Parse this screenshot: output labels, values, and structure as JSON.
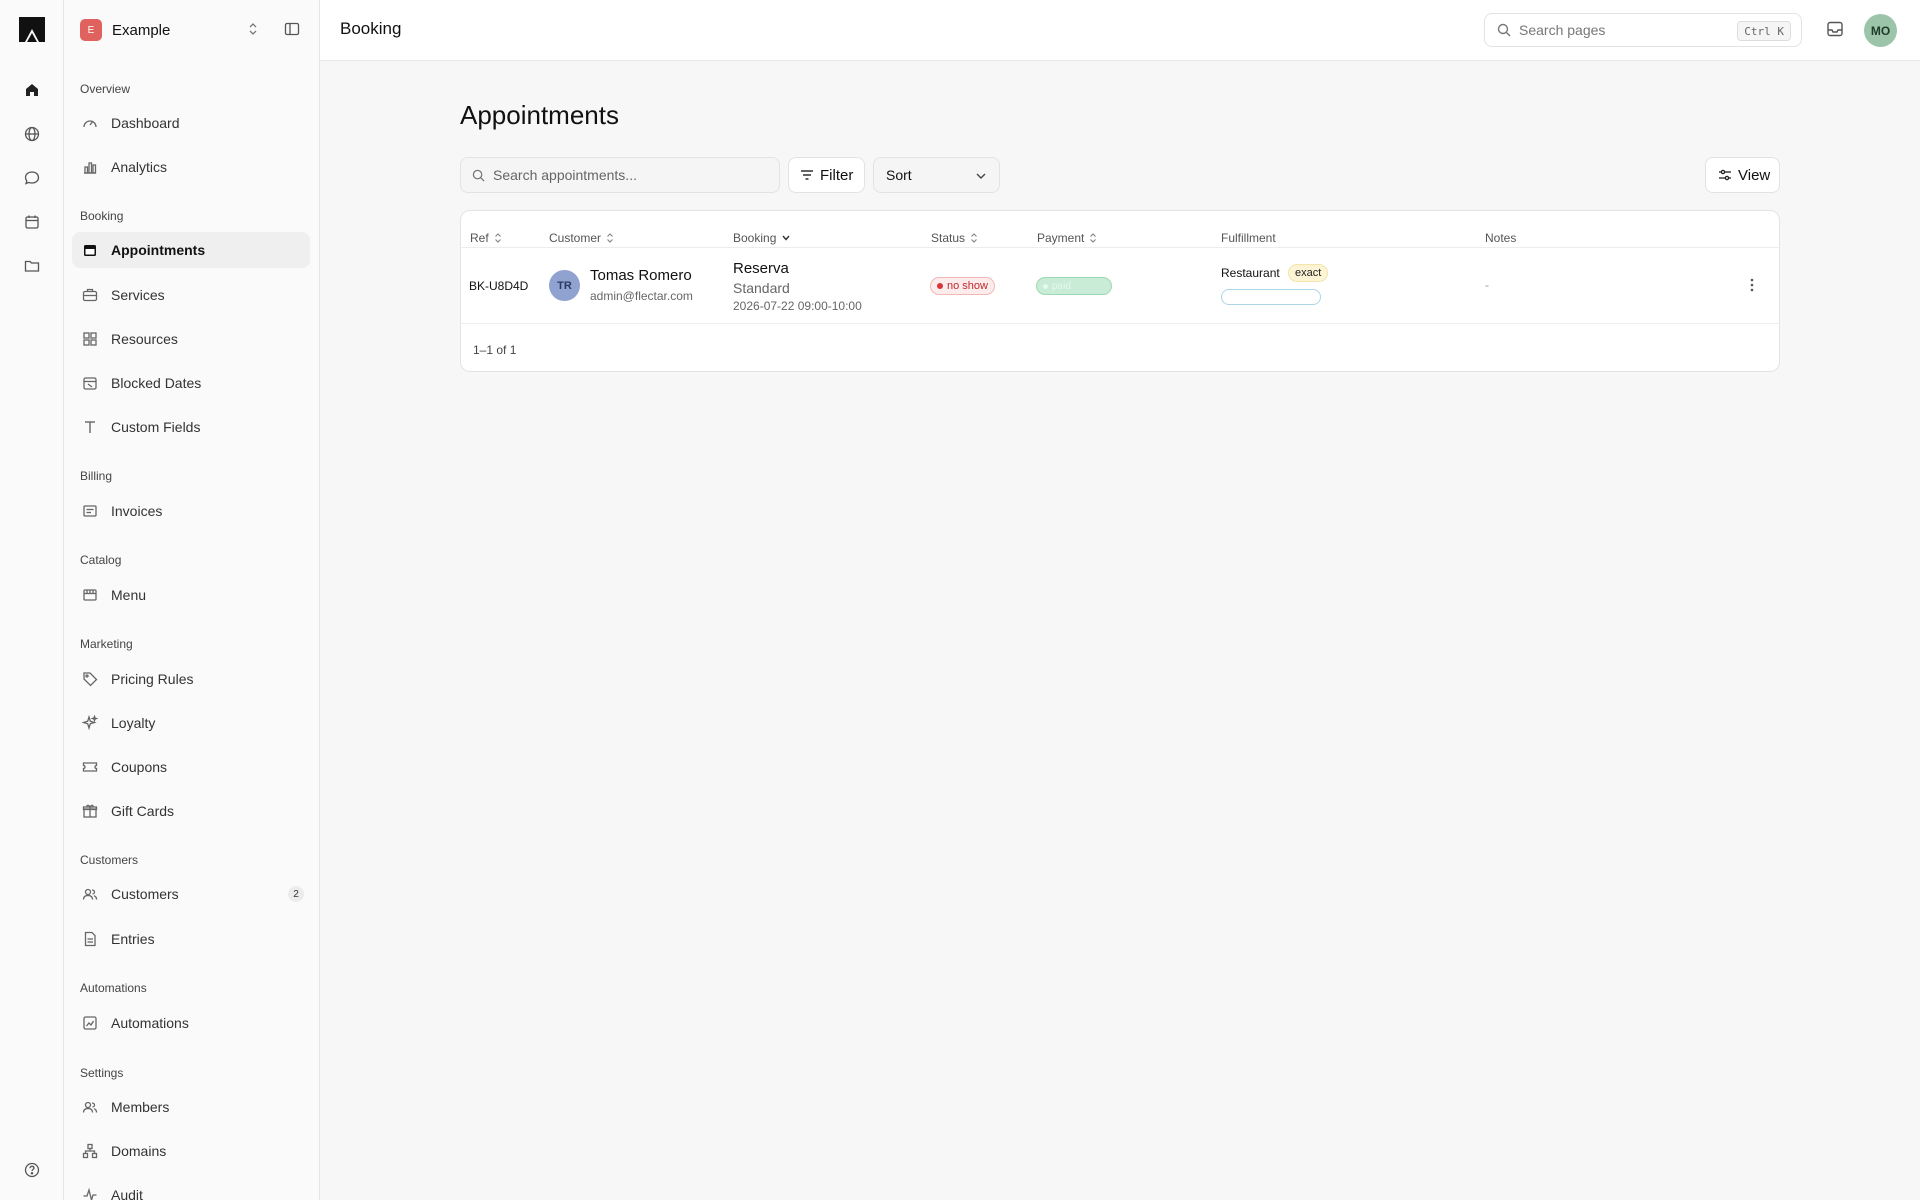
{
  "app": {
    "workspace_initial": "E",
    "workspace_name": "Example"
  },
  "header": {
    "title": "Booking",
    "search_placeholder": "Search pages",
    "shortcut": "Ctrl K",
    "avatar": "MO"
  },
  "sidebar": {
    "overview": "Overview",
    "dashboard": "Dashboard",
    "analytics": "Analytics",
    "booking": "Booking",
    "appointments": "Appointments",
    "services": "Services",
    "resources": "Resources",
    "blocked_dates": "Blocked Dates",
    "custom_fields": "Custom Fields",
    "billing": "Billing",
    "invoices": "Invoices",
    "catalog": "Catalog",
    "menu": "Menu",
    "marketing": "Marketing",
    "pricing_rules": "Pricing Rules",
    "loyalty": "Loyalty",
    "coupons": "Coupons",
    "gift_cards": "Gift Cards",
    "customers_section": "Customers",
    "customers": "Customers",
    "customers_count": "2",
    "entries": "Entries",
    "automations_section": "Automations",
    "automations": "Automations",
    "settings": "Settings",
    "members": "Members",
    "domains": "Domains",
    "audit": "Audit"
  },
  "main": {
    "title": "Appointments",
    "search_placeholder": "Search appointments...",
    "filter_label": "Filter",
    "sort_label": "Sort",
    "view_label": "View"
  },
  "table": {
    "columns": {
      "ref": "Ref",
      "customer": "Customer",
      "booking": "Booking",
      "status": "Status",
      "payment": "Payment",
      "fulfillment": "Fulfillment",
      "notes": "Notes"
    },
    "rows": [
      {
        "ref": "BK-U8D4D",
        "customer_initials": "TR",
        "customer_name": "Tomas Romero",
        "customer_email": "admin@flectar.com",
        "booking_title": "Reserva",
        "booking_type": "Standard",
        "booking_time": "2026-07-22 09:00-10:00",
        "status": "no show",
        "payment": "paid",
        "fulfillment": "Restaurant",
        "fulfillment_tag": "exact",
        "notes": "-"
      }
    ],
    "pagination": "1–1 of 1"
  },
  "colors": {
    "accent": "#e0625e",
    "status_no_show": "#c0282d",
    "payment": "#c8ecd5",
    "avatar": "#9bc4a8"
  }
}
